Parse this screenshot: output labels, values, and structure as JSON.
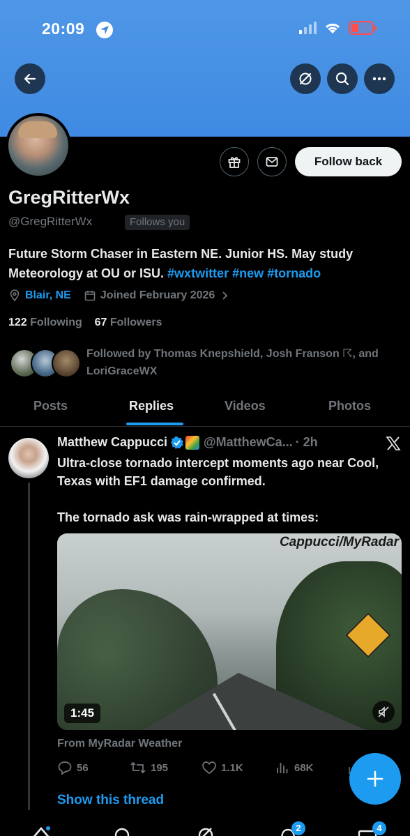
{
  "status_bar": {
    "time": "20:09"
  },
  "profile": {
    "display_name": "GregRitterWx",
    "handle": "@GregRitterWx",
    "follows_you": "Follows you",
    "follow_back_label": "Follow back",
    "bio_text": "Future Storm Chaser in Eastern NE. Junior HS. May study Meteorology at OU or ISU.",
    "bio_hashtags": [
      "#wxtwitter",
      "#new",
      "#tornado"
    ],
    "location": "Blair, NE",
    "joined": "Joined February 2026",
    "following_count": "122",
    "following_label": "Following",
    "followers_count": "67",
    "followers_label": "Followers",
    "followed_by": "Followed by Thomas Knepshield, Josh Franson ☈, and LoriGraceWX"
  },
  "tabs": [
    {
      "label": "Posts",
      "active": false
    },
    {
      "label": "Replies",
      "active": true
    },
    {
      "label": "Videos",
      "active": false
    },
    {
      "label": "Photos",
      "active": false
    }
  ],
  "tweet": {
    "author": "Matthew Cappucci",
    "handle": "@MatthewCa...",
    "time": "· 2h",
    "text_line1": "Ultra-close tornado intercept moments ago near Cool, Texas with EF1 damage confirmed.",
    "text_line2": "The tornado ask was rain-wrapped at times:",
    "media_watermark": "Cappucci/MyRadar",
    "video_duration": "1:45",
    "source": "From MyRadar Weather",
    "replies": "56",
    "reposts": "195",
    "likes": "1.1K",
    "views": "68K",
    "show_thread": "Show this thread"
  },
  "nav": {
    "notifications_badge": "2",
    "messages_badge": "4"
  },
  "colors": {
    "accent": "#1d9bf0",
    "banner": "#4a93e5",
    "background": "#000000"
  }
}
